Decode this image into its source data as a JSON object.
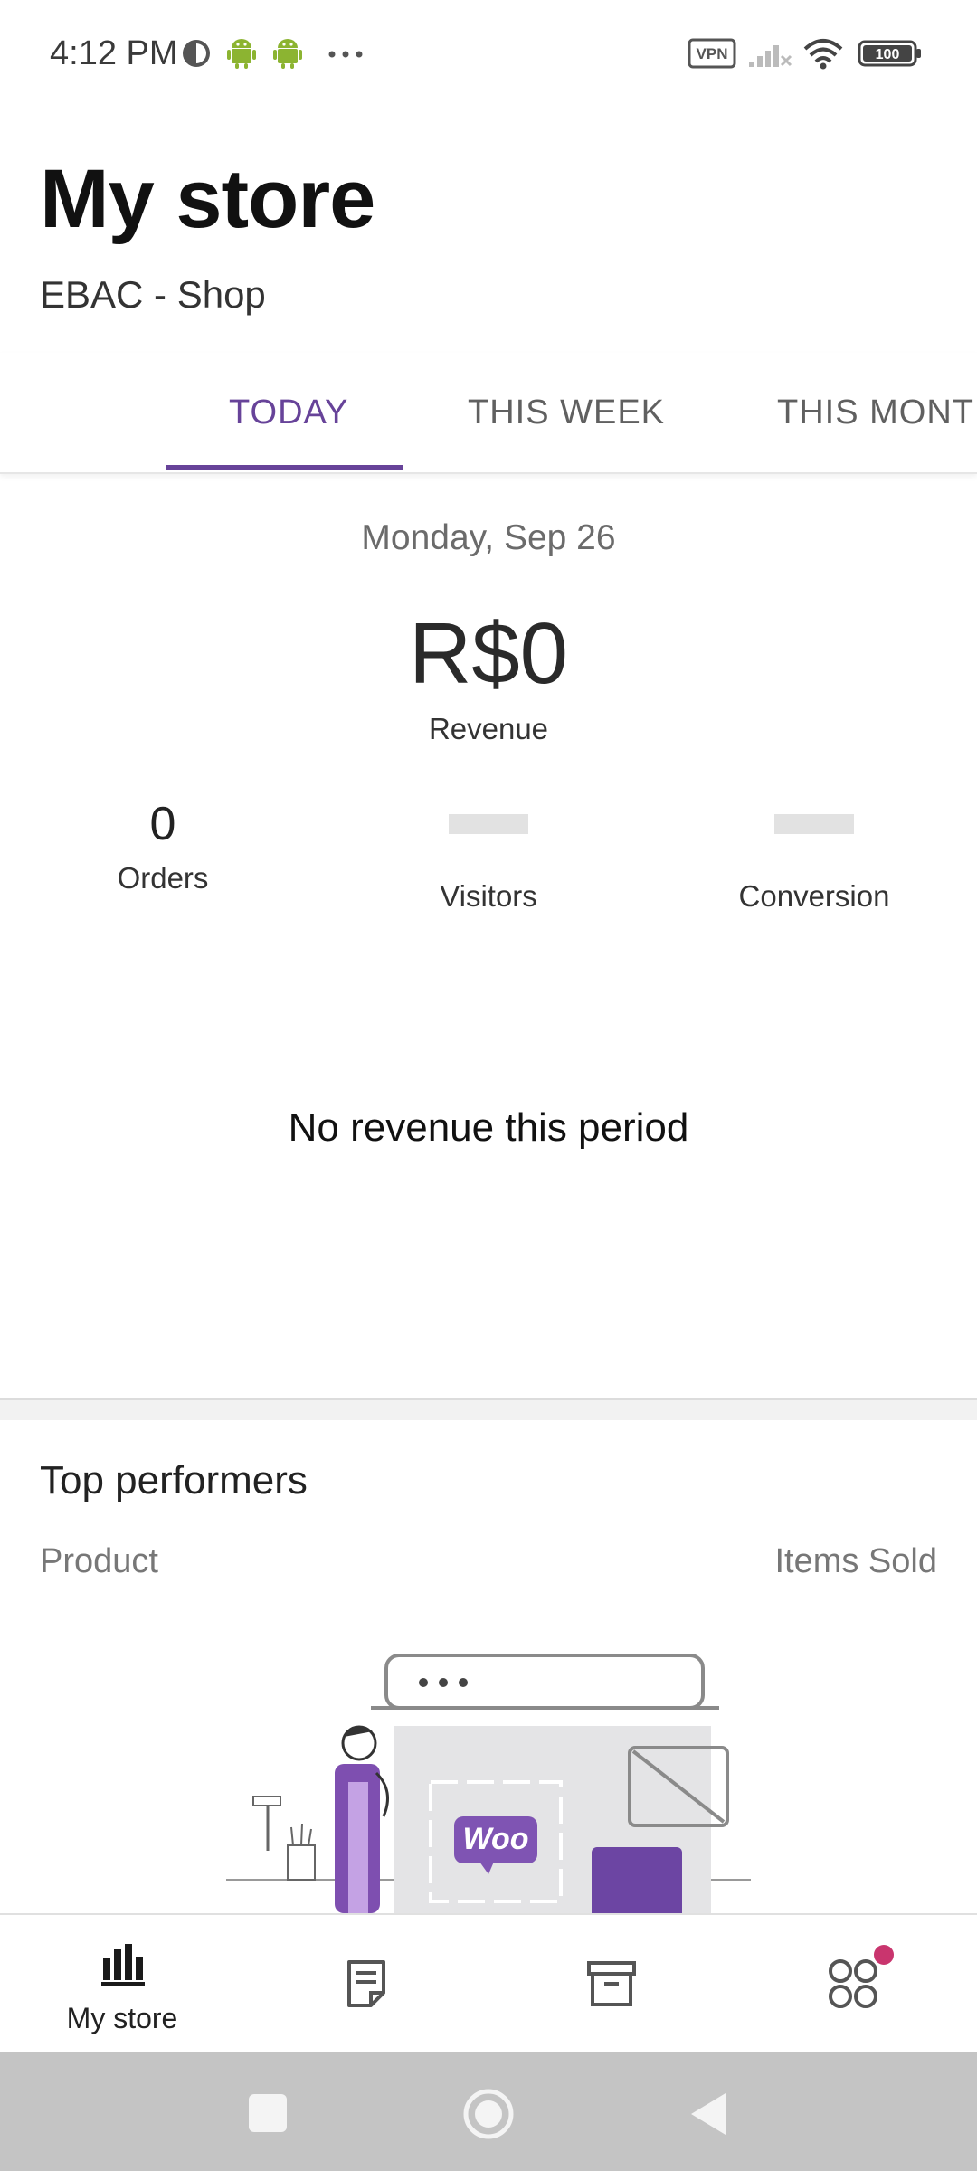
{
  "status_bar": {
    "time": "4:12 PM",
    "vpn_label": "VPN",
    "battery": "100"
  },
  "header": {
    "title": "My store",
    "subtitle": "EBAC - Shop"
  },
  "tabs": [
    {
      "label": "TODAY",
      "active": true
    },
    {
      "label": "THIS WEEK",
      "active": false
    },
    {
      "label": "THIS MONTH",
      "active": false
    }
  ],
  "stats": {
    "date": "Monday, Sep 26",
    "revenue_value": "R$0",
    "revenue_label": "Revenue",
    "orders": {
      "value": "0",
      "label": "Orders"
    },
    "visitors": {
      "label": "Visitors"
    },
    "conversion": {
      "label": "Conversion"
    },
    "empty_message": "No revenue this period"
  },
  "top_performers": {
    "title": "Top performers",
    "col_product": "Product",
    "col_items_sold": "Items Sold",
    "illustration_logo": "Woo"
  },
  "bottom_nav": [
    {
      "label": "My store",
      "icon": "bar-chart-icon",
      "active": true
    },
    {
      "label": "",
      "icon": "orders-icon",
      "active": false
    },
    {
      "label": "",
      "icon": "products-icon",
      "active": false
    },
    {
      "label": "",
      "icon": "more-menu-icon",
      "active": false,
      "badge": true
    }
  ],
  "colors": {
    "accent": "#674399",
    "badge": "#c9356e"
  }
}
